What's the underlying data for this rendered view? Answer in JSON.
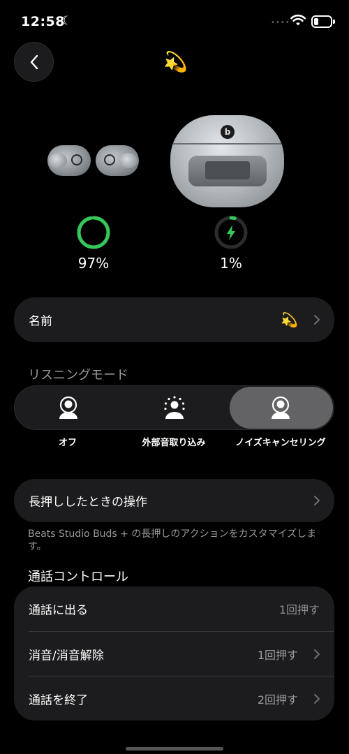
{
  "status_bar": {
    "time": "12:58",
    "moon_icon": "☾",
    "signal_dots": "••••"
  },
  "header": {
    "back_icon": "chevron-left",
    "device_emoji": "💫"
  },
  "battery": {
    "buds": {
      "label": "97%",
      "level": 0.97,
      "color": "#34c759"
    },
    "case": {
      "label": "1%",
      "level": 0.01,
      "color": "#34c759",
      "charging": true
    }
  },
  "name_row": {
    "label": "名前",
    "value": "💫"
  },
  "listening_mode": {
    "title": "リスニングモード",
    "options": [
      {
        "label": "オフ",
        "selected": false
      },
      {
        "label": "外部音取り込み",
        "selected": false
      },
      {
        "label": "ノイズキャンセリング",
        "selected": true
      }
    ]
  },
  "press_hold": {
    "label": "長押ししたときの操作",
    "description": "Beats Studio Buds + の長押しのアクションをカスタマイズします。"
  },
  "call_controls": {
    "title": "通話コントロール",
    "rows": [
      {
        "label": "通話に出る",
        "value": "1回押す",
        "chevron": false
      },
      {
        "label": "消音/消音解除",
        "value": "1回押す",
        "chevron": true
      },
      {
        "label": "通話を終了",
        "value": "2回押す",
        "chevron": true
      }
    ]
  },
  "colors": {
    "background": "#000000",
    "card": "#1c1c1e",
    "accent_green": "#34c759",
    "secondary_text": "#9a9a9e"
  }
}
